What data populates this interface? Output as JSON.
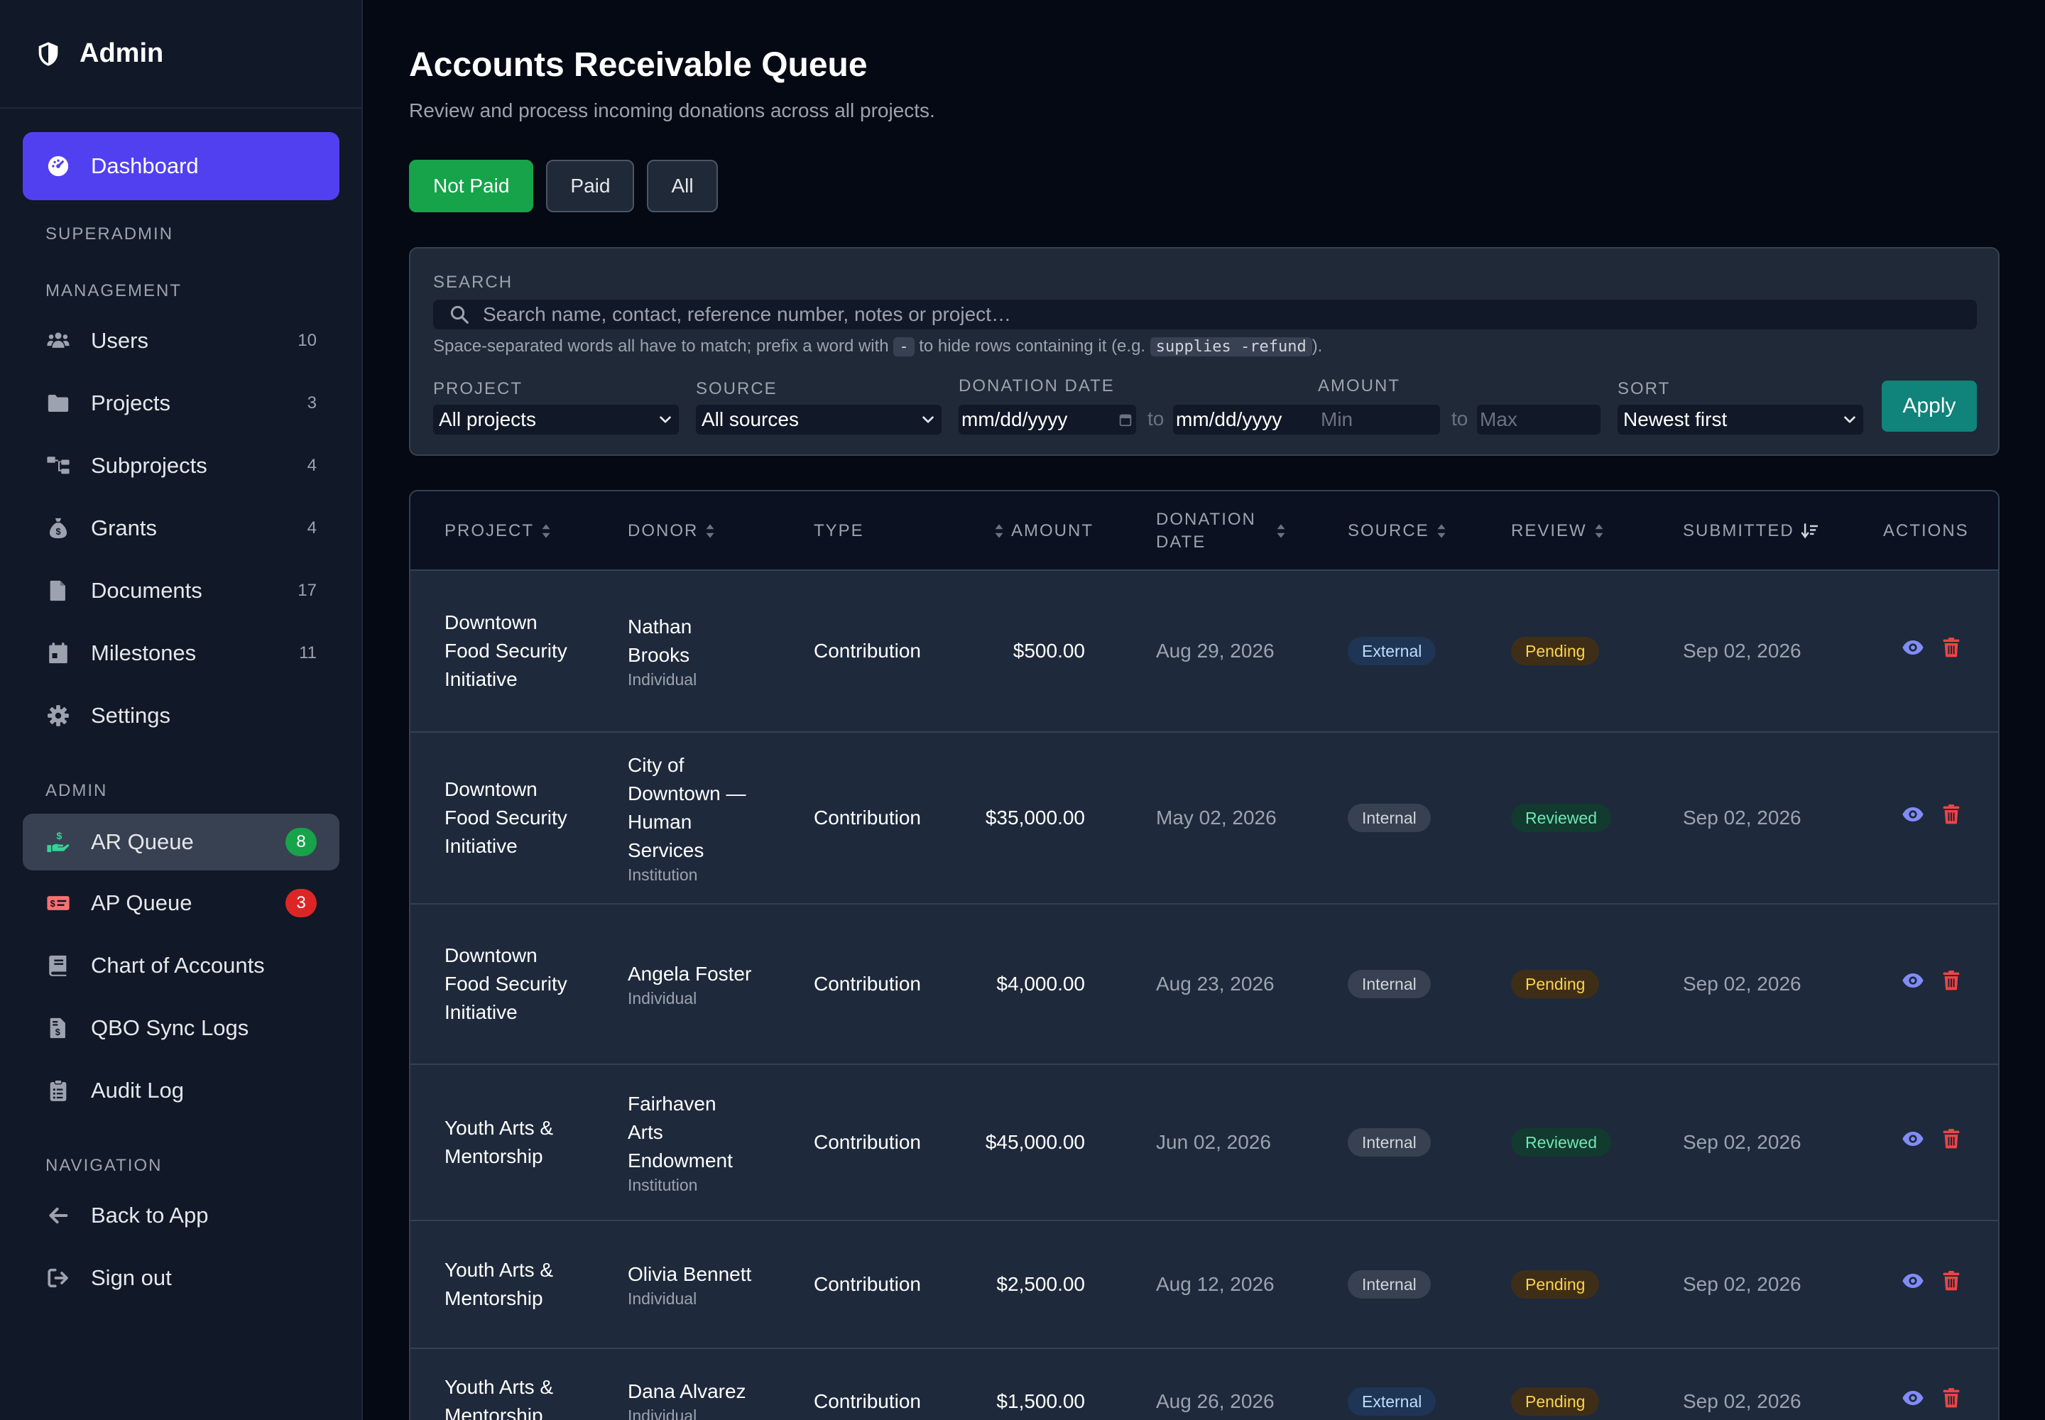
{
  "sidebar": {
    "brand": "Admin",
    "dashboard": "Dashboard",
    "sections": {
      "superadmin": "SUPERADMIN",
      "management": "MANAGEMENT",
      "admin": "ADMIN",
      "navigation": "NAVIGATION"
    },
    "management_items": [
      {
        "label": "Users",
        "count": "10",
        "icon": "users-icon"
      },
      {
        "label": "Projects",
        "count": "3",
        "icon": "folder-icon"
      },
      {
        "label": "Subprojects",
        "count": "4",
        "icon": "sitemap-icon"
      },
      {
        "label": "Grants",
        "count": "4",
        "icon": "money-bag-icon"
      },
      {
        "label": "Documents",
        "count": "17",
        "icon": "document-icon"
      },
      {
        "label": "Milestones",
        "count": "11",
        "icon": "calendar-icon"
      },
      {
        "label": "Settings",
        "count": "",
        "icon": "gear-icon"
      }
    ],
    "admin_items": [
      {
        "label": "AR Queue",
        "badge": "8"
      },
      {
        "label": "AP Queue",
        "badge": "3"
      },
      {
        "label": "Chart of Accounts"
      },
      {
        "label": "QBO Sync Logs"
      },
      {
        "label": "Audit Log"
      }
    ],
    "nav_items": [
      {
        "label": "Back to App"
      },
      {
        "label": "Sign out"
      }
    ]
  },
  "header": {
    "title": "Accounts Receivable Queue",
    "subtitle": "Review and process incoming donations across all projects."
  },
  "tabs": [
    "Not Paid",
    "Paid",
    "All"
  ],
  "filters": {
    "search_label": "SEARCH",
    "search_placeholder": "Search name, contact, reference number, notes or project…",
    "hint_before": "Space-separated words all have to match; prefix a word with ",
    "hint_code1": "-",
    "hint_mid": " to hide rows containing it (e.g. ",
    "hint_code2": "supplies -refund",
    "hint_after": ").",
    "project_label": "PROJECT",
    "project_value": "All projects",
    "source_label": "SOURCE",
    "source_value": "All sources",
    "date_label": "DONATION DATE",
    "date_from": "mm/dd/yyyy",
    "date_to": "mm/dd/yyyy",
    "to": "to",
    "amount_label": "AMOUNT",
    "amount_min": "Min",
    "amount_max": "Max",
    "sort_label": "SORT",
    "sort_value": "Newest first",
    "apply": "Apply"
  },
  "table": {
    "columns": {
      "project": "PROJECT",
      "donor": "DONOR",
      "type": "TYPE",
      "amount": "AMOUNT",
      "donation_date_1": "DONATION",
      "donation_date_2": "DATE",
      "source": "SOURCE",
      "review": "REVIEW",
      "submitted": "SUBMITTED",
      "actions": "ACTIONS"
    },
    "rows": [
      {
        "project": "Downtown Food Security Initiative",
        "donor": "Nathan Brooks",
        "donor_type": "Individual",
        "type": "Contribution",
        "amount": "$500.00",
        "date": "Aug 29, 2026",
        "source": "External",
        "review": "Pending",
        "submitted": "Sep 02, 2026"
      },
      {
        "project": "Downtown Food Security Initiative",
        "donor": "City of Downtown — Human Services",
        "donor_type": "Institution",
        "type": "Contribution",
        "amount": "$35,000.00",
        "date": "May 02, 2026",
        "source": "Internal",
        "review": "Reviewed",
        "submitted": "Sep 02, 2026"
      },
      {
        "project": "Downtown Food Security Initiative",
        "donor": "Angela Foster",
        "donor_type": "Individual",
        "type": "Contribution",
        "amount": "$4,000.00",
        "date": "Aug 23, 2026",
        "source": "Internal",
        "review": "Pending",
        "submitted": "Sep 02, 2026"
      },
      {
        "project": "Youth Arts & Mentorship",
        "donor": "Fairhaven Arts Endowment",
        "donor_type": "Institution",
        "type": "Contribution",
        "amount": "$45,000.00",
        "date": "Jun 02, 2026",
        "source": "Internal",
        "review": "Reviewed",
        "submitted": "Sep 02, 2026"
      },
      {
        "project": "Youth Arts & Mentorship",
        "donor": "Olivia Bennett",
        "donor_type": "Individual",
        "type": "Contribution",
        "amount": "$2,500.00",
        "date": "Aug 12, 2026",
        "source": "Internal",
        "review": "Pending",
        "submitted": "Sep 02, 2026"
      },
      {
        "project": "Youth Arts & Mentorship",
        "donor": "Dana Alvarez",
        "donor_type": "Individual",
        "type": "Contribution",
        "amount": "$1,500.00",
        "date": "Aug 26, 2026",
        "source": "External",
        "review": "Pending",
        "submitted": "Sep 02, 2026"
      }
    ]
  },
  "colors": {
    "accent": "#5140f0",
    "success": "#16a34a",
    "danger": "#dc2626",
    "apply": "#10837a",
    "view_icon": "#818cf8",
    "delete_icon": "#ef4444"
  }
}
